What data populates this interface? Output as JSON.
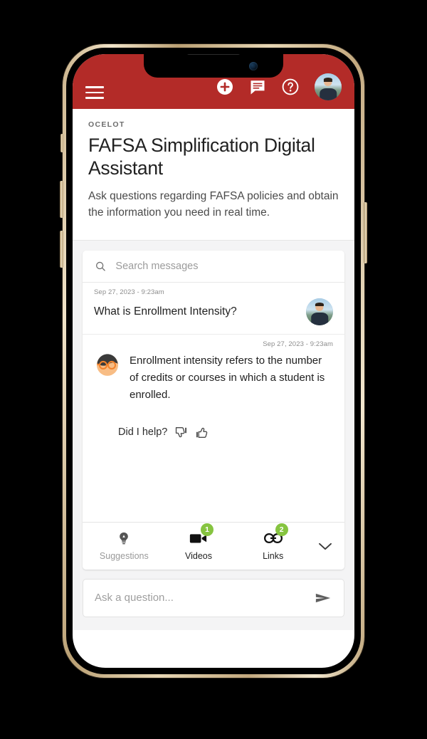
{
  "app": {
    "brand_red": "#b32b28",
    "badge_green": "#86c440",
    "eyebrow": "OCELOT",
    "title": "FAFSA Simplification Digital Assistant",
    "subtitle": "Ask questions regarding FAFSA policies and obtain the information you need in real time."
  },
  "appbar": {
    "menu_icon": "hamburger-menu-icon",
    "actions": [
      {
        "name": "add-icon",
        "label": "Add"
      },
      {
        "name": "chat-icon",
        "label": "Messages"
      },
      {
        "name": "help-icon",
        "label": "Help"
      }
    ],
    "avatar": "user-avatar"
  },
  "search": {
    "placeholder": "Search messages",
    "value": "",
    "icon": "search-icon"
  },
  "messages": [
    {
      "sender": "user",
      "timestamp": "Sep 27, 2023 - 9:23am",
      "text": "What is Enrollment Intensity?"
    },
    {
      "sender": "bot",
      "timestamp": "Sep 27, 2023 - 9:23am",
      "text": "Enrollment intensity refers to the number of credits or courses in which a student is enrolled."
    }
  ],
  "feedback": {
    "label": "Did I help?",
    "thumbs_down": "thumbs-down-icon",
    "thumbs_up": "thumbs-up-icon"
  },
  "tabs": [
    {
      "label": "Suggestions",
      "icon": "lightbulb-icon",
      "badge": "",
      "active": false
    },
    {
      "label": "Videos",
      "icon": "video-camera-icon",
      "badge": "1",
      "active": true
    },
    {
      "label": "Links",
      "icon": "link-icon",
      "badge": "2",
      "active": true
    }
  ],
  "tabstrip": {
    "collapse_icon": "chevron-down-icon"
  },
  "composer": {
    "placeholder": "Ask a question...",
    "value": "",
    "send_icon": "send-icon"
  }
}
